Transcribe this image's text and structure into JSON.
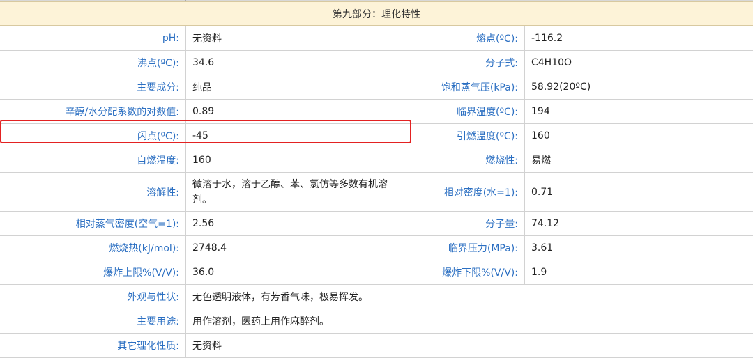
{
  "section": {
    "title": "第九部分：理化特性"
  },
  "rows": [
    {
      "k1": "pH:",
      "v1": "无资料",
      "k2": "熔点(ºC):",
      "v2": "-116.2"
    },
    {
      "k1": "沸点(ºC):",
      "v1": "34.6",
      "k2": "分子式:",
      "v2": "C4H10O"
    },
    {
      "k1": "主要成分:",
      "v1": "纯品",
      "k2": "饱和蒸气压(kPa):",
      "v2": "58.92(20ºC)"
    },
    {
      "k1": "辛醇/水分配系数的对数值:",
      "v1": "0.89",
      "k2": "临界温度(ºC):",
      "v2": "194"
    },
    {
      "k1": "闪点(ºC):",
      "v1": "-45",
      "k2": "引燃温度(ºC):",
      "v2": "160"
    },
    {
      "k1": "自燃温度:",
      "v1": "160",
      "k2": "燃烧性:",
      "v2": "易燃"
    },
    {
      "k1": "溶解性:",
      "v1": "微溶于水，溶于乙醇、苯、氯仿等多数有机溶剂。",
      "k2": "相对密度(水=1):",
      "v2": "0.71"
    },
    {
      "k1": "相对蒸气密度(空气=1):",
      "v1": "2.56",
      "k2": "分子量:",
      "v2": "74.12"
    },
    {
      "k1": "燃烧热(kJ/mol):",
      "v1": "2748.4",
      "k2": "临界压力(MPa):",
      "v2": "3.61"
    },
    {
      "k1": "爆炸上限%(V/V):",
      "v1": "36.0",
      "k2": "爆炸下限%(V/V):",
      "v2": "1.9"
    }
  ],
  "wide_rows": [
    {
      "k": "外观与性状:",
      "v": "无色透明液体，有芳香气味，极易挥发。"
    },
    {
      "k": "主要用途:",
      "v": "用作溶剂，医药上用作麻醉剂。"
    },
    {
      "k": "其它理化性质:",
      "v": "无资料"
    }
  ],
  "highlight": {
    "color": "#e32222",
    "row": "闪点(ºC):"
  }
}
